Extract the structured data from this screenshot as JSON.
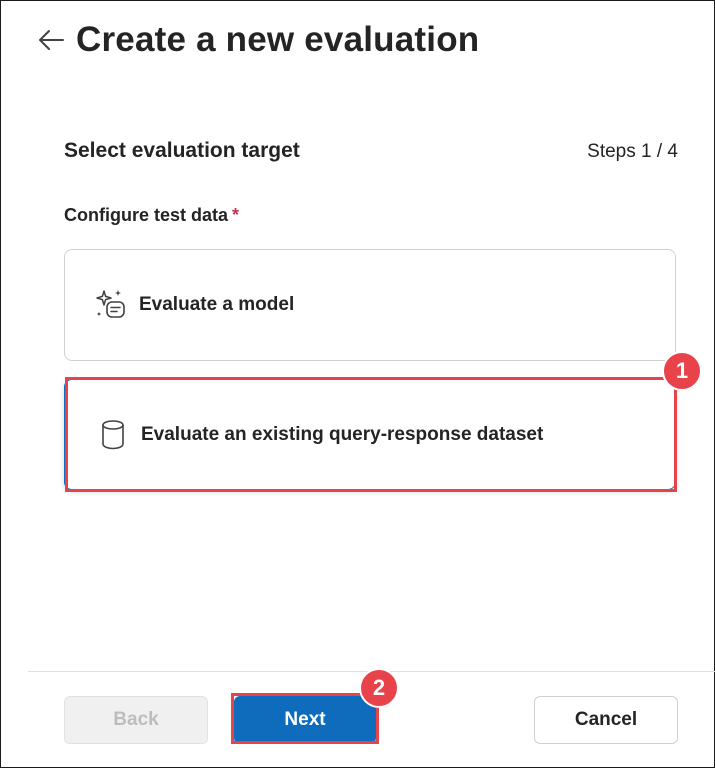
{
  "header": {
    "back_icon": "arrow-left-icon",
    "title": "Create a new evaluation"
  },
  "step": {
    "section_title": "Select evaluation target",
    "progress": "Steps 1 / 4"
  },
  "form": {
    "field_label": "Configure test data",
    "required_marker": "*",
    "options": [
      {
        "icon": "sparkle-chat-icon",
        "label": "Evaluate a model",
        "selected": false
      },
      {
        "icon": "database-icon",
        "label": "Evaluate an existing query-response dataset",
        "selected": true
      }
    ]
  },
  "annotations": [
    {
      "number": "1",
      "color": "#e8434b",
      "target": "dataset-option"
    },
    {
      "number": "2",
      "color": "#e8434b",
      "target": "next-button"
    }
  ],
  "footer": {
    "back_label": "Back",
    "next_label": "Next",
    "cancel_label": "Cancel"
  },
  "colors": {
    "accent": "#0f6cbd",
    "required": "#c4314b",
    "annotation": "#e8434b"
  }
}
